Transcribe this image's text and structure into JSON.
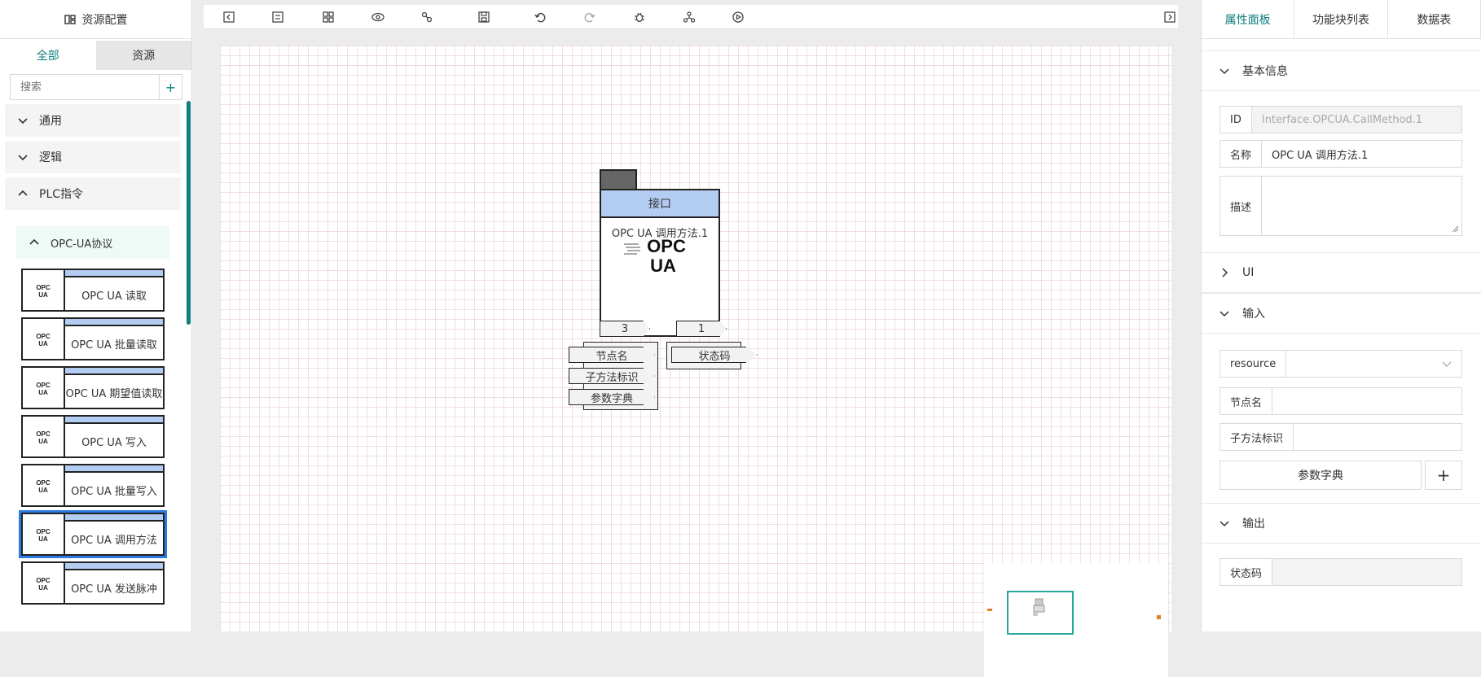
{
  "left": {
    "header_title": "资源配置",
    "tabs": [
      "全部",
      "资源"
    ],
    "search_placeholder": "搜索",
    "search_add": "+",
    "categories": [
      "通用",
      "逻辑",
      "PLC指令"
    ],
    "subcategory": "OPC-UA协议",
    "blocks": [
      "OPC UA 读取",
      "OPC UA 批量读取",
      "OPC UA 期望值读取",
      "OPC UA 写入",
      "OPC UA 批量写入",
      "OPC UA 调用方法",
      "OPC UA 发送脉冲"
    ],
    "logo_text_top": "OPC",
    "logo_text_bottom": "UA"
  },
  "node": {
    "header": "接口",
    "title": "OPC UA 调用方法.1",
    "logo_top": "OPC",
    "logo_bottom": "UA",
    "input_count": "3",
    "output_count": "1",
    "inputs": [
      "节点名",
      "子方法标识",
      "参数字典"
    ],
    "outputs": [
      "状态码"
    ]
  },
  "right": {
    "tabs": [
      "属性面板",
      "功能块列表",
      "数据表"
    ],
    "sections": {
      "basic": "基本信息",
      "ui": "UI",
      "input": "输入",
      "output": "输出"
    },
    "fields": {
      "id_label": "ID",
      "id_value": "Interface.OPCUA.CallMethod.1",
      "name_label": "名称",
      "name_value": "OPC UA 调用方法.1",
      "desc_label": "描述",
      "resource_label": "resource",
      "node_label": "节点名",
      "submethod_label": "子方法标识",
      "params_button": "参数字典",
      "params_add": "+",
      "status_label": "状态码"
    }
  },
  "colors": {
    "accent": "#0f7e7e",
    "block_header": "#b3ccf2",
    "selected_outline": "#2c7be5"
  }
}
